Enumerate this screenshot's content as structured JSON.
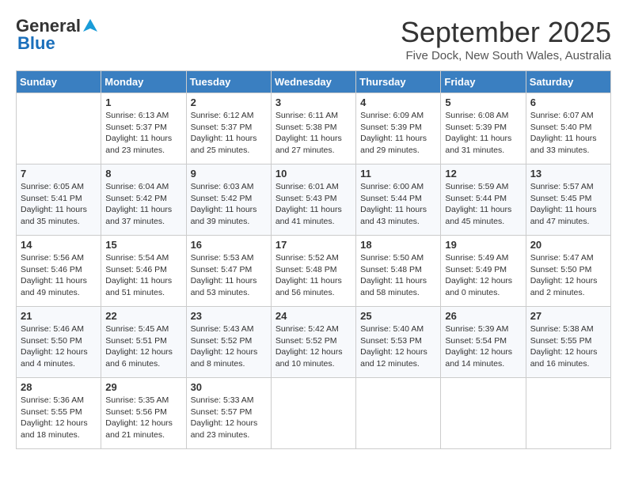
{
  "logo": {
    "general": "General",
    "blue": "Blue"
  },
  "title": "September 2025",
  "location": "Five Dock, New South Wales, Australia",
  "days_of_week": [
    "Sunday",
    "Monday",
    "Tuesday",
    "Wednesday",
    "Thursday",
    "Friday",
    "Saturday"
  ],
  "weeks": [
    [
      {
        "day": "",
        "info": ""
      },
      {
        "day": "1",
        "info": "Sunrise: 6:13 AM\nSunset: 5:37 PM\nDaylight: 11 hours\nand 23 minutes."
      },
      {
        "day": "2",
        "info": "Sunrise: 6:12 AM\nSunset: 5:37 PM\nDaylight: 11 hours\nand 25 minutes."
      },
      {
        "day": "3",
        "info": "Sunrise: 6:11 AM\nSunset: 5:38 PM\nDaylight: 11 hours\nand 27 minutes."
      },
      {
        "day": "4",
        "info": "Sunrise: 6:09 AM\nSunset: 5:39 PM\nDaylight: 11 hours\nand 29 minutes."
      },
      {
        "day": "5",
        "info": "Sunrise: 6:08 AM\nSunset: 5:39 PM\nDaylight: 11 hours\nand 31 minutes."
      },
      {
        "day": "6",
        "info": "Sunrise: 6:07 AM\nSunset: 5:40 PM\nDaylight: 11 hours\nand 33 minutes."
      }
    ],
    [
      {
        "day": "7",
        "info": "Sunrise: 6:05 AM\nSunset: 5:41 PM\nDaylight: 11 hours\nand 35 minutes."
      },
      {
        "day": "8",
        "info": "Sunrise: 6:04 AM\nSunset: 5:42 PM\nDaylight: 11 hours\nand 37 minutes."
      },
      {
        "day": "9",
        "info": "Sunrise: 6:03 AM\nSunset: 5:42 PM\nDaylight: 11 hours\nand 39 minutes."
      },
      {
        "day": "10",
        "info": "Sunrise: 6:01 AM\nSunset: 5:43 PM\nDaylight: 11 hours\nand 41 minutes."
      },
      {
        "day": "11",
        "info": "Sunrise: 6:00 AM\nSunset: 5:44 PM\nDaylight: 11 hours\nand 43 minutes."
      },
      {
        "day": "12",
        "info": "Sunrise: 5:59 AM\nSunset: 5:44 PM\nDaylight: 11 hours\nand 45 minutes."
      },
      {
        "day": "13",
        "info": "Sunrise: 5:57 AM\nSunset: 5:45 PM\nDaylight: 11 hours\nand 47 minutes."
      }
    ],
    [
      {
        "day": "14",
        "info": "Sunrise: 5:56 AM\nSunset: 5:46 PM\nDaylight: 11 hours\nand 49 minutes."
      },
      {
        "day": "15",
        "info": "Sunrise: 5:54 AM\nSunset: 5:46 PM\nDaylight: 11 hours\nand 51 minutes."
      },
      {
        "day": "16",
        "info": "Sunrise: 5:53 AM\nSunset: 5:47 PM\nDaylight: 11 hours\nand 53 minutes."
      },
      {
        "day": "17",
        "info": "Sunrise: 5:52 AM\nSunset: 5:48 PM\nDaylight: 11 hours\nand 56 minutes."
      },
      {
        "day": "18",
        "info": "Sunrise: 5:50 AM\nSunset: 5:48 PM\nDaylight: 11 hours\nand 58 minutes."
      },
      {
        "day": "19",
        "info": "Sunrise: 5:49 AM\nSunset: 5:49 PM\nDaylight: 12 hours\nand 0 minutes."
      },
      {
        "day": "20",
        "info": "Sunrise: 5:47 AM\nSunset: 5:50 PM\nDaylight: 12 hours\nand 2 minutes."
      }
    ],
    [
      {
        "day": "21",
        "info": "Sunrise: 5:46 AM\nSunset: 5:50 PM\nDaylight: 12 hours\nand 4 minutes."
      },
      {
        "day": "22",
        "info": "Sunrise: 5:45 AM\nSunset: 5:51 PM\nDaylight: 12 hours\nand 6 minutes."
      },
      {
        "day": "23",
        "info": "Sunrise: 5:43 AM\nSunset: 5:52 PM\nDaylight: 12 hours\nand 8 minutes."
      },
      {
        "day": "24",
        "info": "Sunrise: 5:42 AM\nSunset: 5:52 PM\nDaylight: 12 hours\nand 10 minutes."
      },
      {
        "day": "25",
        "info": "Sunrise: 5:40 AM\nSunset: 5:53 PM\nDaylight: 12 hours\nand 12 minutes."
      },
      {
        "day": "26",
        "info": "Sunrise: 5:39 AM\nSunset: 5:54 PM\nDaylight: 12 hours\nand 14 minutes."
      },
      {
        "day": "27",
        "info": "Sunrise: 5:38 AM\nSunset: 5:55 PM\nDaylight: 12 hours\nand 16 minutes."
      }
    ],
    [
      {
        "day": "28",
        "info": "Sunrise: 5:36 AM\nSunset: 5:55 PM\nDaylight: 12 hours\nand 18 minutes."
      },
      {
        "day": "29",
        "info": "Sunrise: 5:35 AM\nSunset: 5:56 PM\nDaylight: 12 hours\nand 21 minutes."
      },
      {
        "day": "30",
        "info": "Sunrise: 5:33 AM\nSunset: 5:57 PM\nDaylight: 12 hours\nand 23 minutes."
      },
      {
        "day": "",
        "info": ""
      },
      {
        "day": "",
        "info": ""
      },
      {
        "day": "",
        "info": ""
      },
      {
        "day": "",
        "info": ""
      }
    ]
  ]
}
